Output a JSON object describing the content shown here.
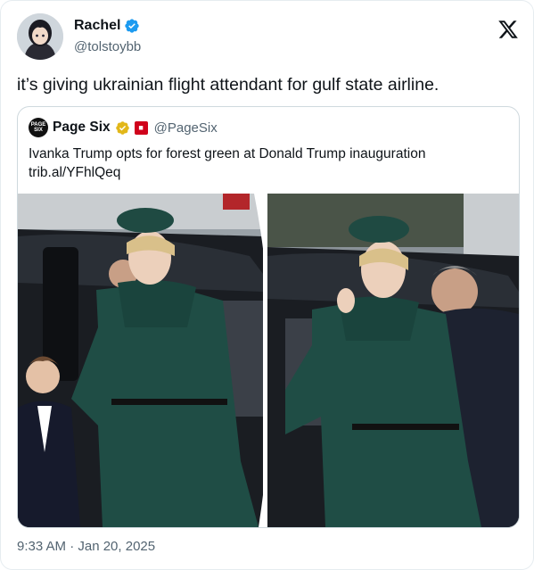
{
  "author": {
    "name": "Rachel",
    "handle": "@tolstoybb"
  },
  "tweet": {
    "text": "it’s giving ukrainian flight attendant for gulf state airline.",
    "timestamp": "9:33 AM · Jan 20, 2025"
  },
  "quoted": {
    "avatar_text": "PAGE SIX",
    "name": "Page Six",
    "handle": "@PageSix",
    "text_line1": "Ivanka Trump opts for forest green at Donald Trump inauguration",
    "text_line2": "trib.al/YFhlQeq"
  },
  "colors": {
    "verified_blue": "#1d9bf0",
    "verified_gold": "#e2b719",
    "affiliate_red": "#d0021b",
    "outfit_green": "#1f4d45"
  }
}
